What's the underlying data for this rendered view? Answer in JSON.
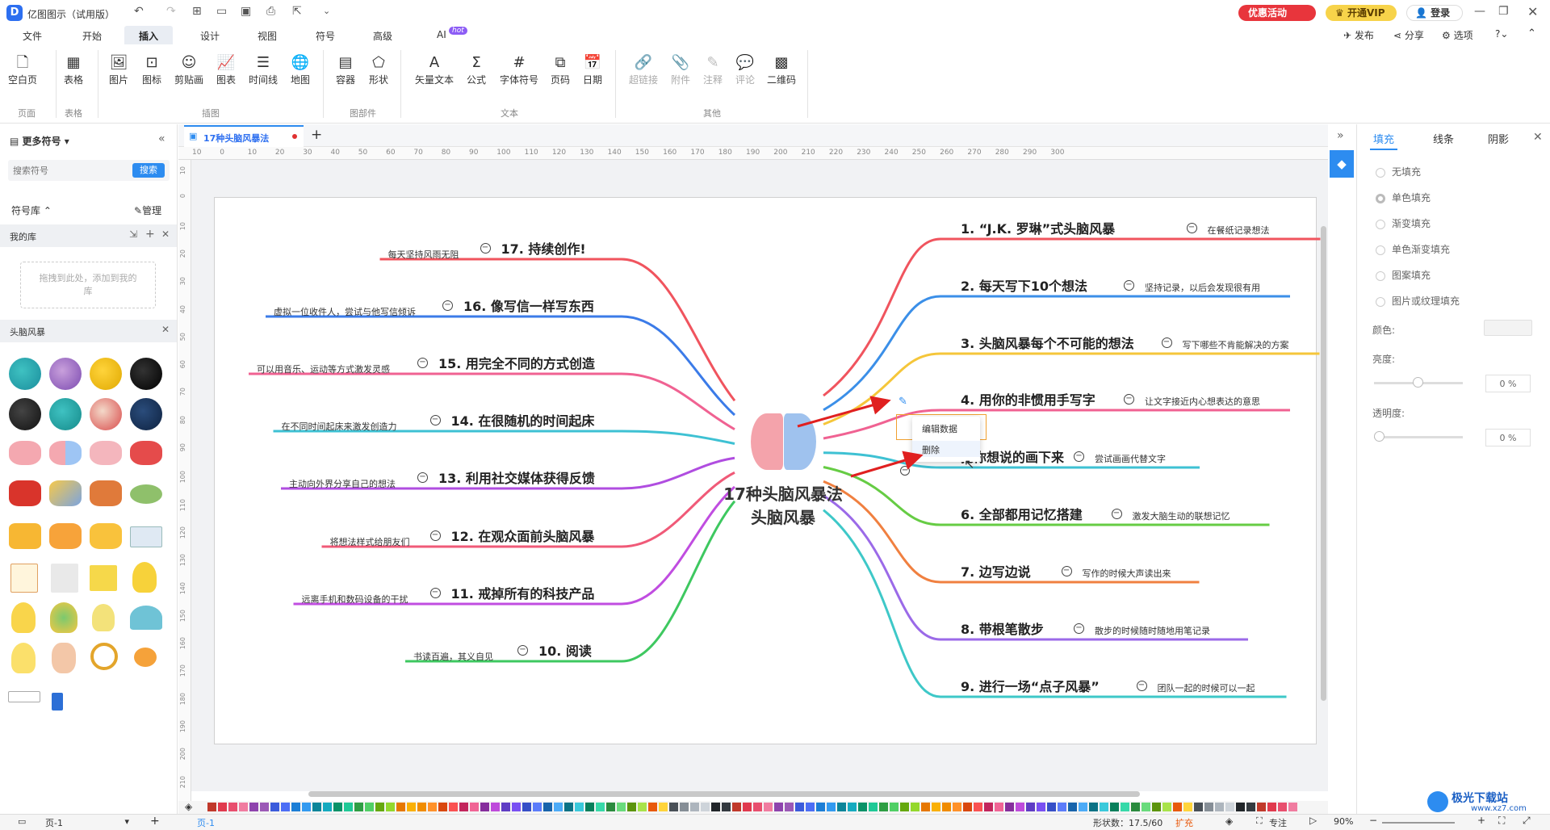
{
  "app": {
    "title": "亿图图示（试用版）",
    "promo_label": "优惠活动",
    "vip_label": "开通VIP",
    "login_label": "登录",
    "publish_label": "发布",
    "share_label": "分享",
    "options_label": "选项"
  },
  "menu": [
    {
      "label": "文件"
    },
    {
      "label": "开始"
    },
    {
      "label": "插入"
    },
    {
      "label": "设计"
    },
    {
      "label": "视图"
    },
    {
      "label": "符号"
    },
    {
      "label": "高级"
    },
    {
      "label": "AI"
    }
  ],
  "ai_badge": "hot",
  "ribbon": {
    "buttons": [
      {
        "label": "空白页"
      },
      {
        "label": "表格"
      },
      {
        "label": "图片"
      },
      {
        "label": "图标"
      },
      {
        "label": "剪贴画"
      },
      {
        "label": "图表"
      },
      {
        "label": "时间线"
      },
      {
        "label": "地图"
      },
      {
        "label": "容器"
      },
      {
        "label": "形状"
      },
      {
        "label": "矢量文本"
      },
      {
        "label": "公式"
      },
      {
        "label": "字体符号"
      },
      {
        "label": "页码"
      },
      {
        "label": "日期"
      },
      {
        "label": "超链接"
      },
      {
        "label": "附件"
      },
      {
        "label": "注释"
      },
      {
        "label": "评论"
      },
      {
        "label": "二维码"
      }
    ],
    "groups": [
      {
        "label": "页面"
      },
      {
        "label": "表格"
      },
      {
        "label": "插图"
      },
      {
        "label": "图部件"
      },
      {
        "label": "文本"
      },
      {
        "label": "其他"
      }
    ]
  },
  "left_panel": {
    "title": "更多符号",
    "search_placeholder": "搜索符号",
    "search_button": "搜索",
    "library_label": "符号库",
    "manage_label": "管理",
    "my_library": "我的库",
    "drop_hint": "拖拽到此处，添加到我的库",
    "category": "头脑风暴"
  },
  "tab": {
    "name": "17种头脑风暴法"
  },
  "ruler": {
    "top": [
      "10",
      "0",
      "10",
      "20",
      "30",
      "40",
      "50",
      "60",
      "70",
      "80",
      "90",
      "100",
      "110",
      "120",
      "130",
      "140",
      "150",
      "160",
      "170",
      "180",
      "190",
      "200",
      "210",
      "220",
      "230",
      "240",
      "250",
      "260",
      "270",
      "280",
      "290",
      "300"
    ],
    "left": [
      "10",
      "0",
      "10",
      "20",
      "30",
      "40",
      "50",
      "60",
      "70",
      "80",
      "90",
      "100",
      "110",
      "120",
      "130",
      "140",
      "150",
      "160",
      "170",
      "180",
      "190",
      "200",
      "210"
    ]
  },
  "mindmap": {
    "center_line1": "17种头脑风暴法",
    "center_line2": "头脑风暴",
    "right": [
      {
        "title": "1. “J.K. 罗琳”式头脑风暴",
        "note": "在餐纸记录想法",
        "color": "#f0545e"
      },
      {
        "title": "2. 每天写下10个想法",
        "note": "坚持记录，以后会发现很有用",
        "color": "#3b8fe8"
      },
      {
        "title": "3. 头脑风暴每个不可能的想法",
        "note": "写下哪些不肯能解决的方案",
        "color": "#f5c63a"
      },
      {
        "title": "4. 用你的非惯用手写字",
        "note": "让文字接近内心想表达的意思",
        "color": "#f06292"
      },
      {
        "title": "把你想说的画下来",
        "note": "尝试画画代替文字",
        "color": "#3ec1d3"
      },
      {
        "title": "6. 全部都用记忆搭建",
        "note": "激发大脑生动的联想记忆",
        "color": "#66cc44"
      },
      {
        "title": "7. 边写边说",
        "note": "写作的时候大声读出来",
        "color": "#f08040"
      },
      {
        "title": "8. 带根笔散步",
        "note": "散步的时候随时随地用笔记录",
        "color": "#9b6ae8"
      },
      {
        "title": "9. 进行一场“点子风暴”",
        "note": "团队一起的时候可以一起",
        "color": "#3ec8c8"
      }
    ],
    "left": [
      {
        "title": "17. 持续创作!",
        "note": "每天坚持风雨无阻",
        "color": "#f0545e"
      },
      {
        "title": "16. 像写信一样写东西",
        "note": "虚拟一位收件人，尝试与他写信倾诉",
        "color": "#3b7be8"
      },
      {
        "title": "15. 用完全不同的方式创造",
        "note": "可以用音乐、运动等方式激发灵感",
        "color": "#f06292"
      },
      {
        "title": "14. 在很随机的时间起床",
        "note": "在不同时间起床来激发创造力",
        "color": "#3ec1d3"
      },
      {
        "title": "13. 利用社交媒体获得反馈",
        "note": "主动向外界分享自己的想法",
        "color": "#b04de0"
      },
      {
        "title": "12. 在观众面前头脑风暴",
        "note": "将想法样式给朋友们",
        "color": "#f05a78"
      },
      {
        "title": "11. 戒掉所有的科技产品",
        "note": "远离手机和数码设备的干扰",
        "color": "#c04de0"
      },
      {
        "title": "10. 阅读",
        "note": "书读百遍，其义自见",
        "color": "#3ec860"
      }
    ]
  },
  "context_menu": {
    "items": [
      {
        "label": "编辑数据"
      },
      {
        "label": "删除"
      }
    ]
  },
  "right_panel": {
    "tabs": [
      {
        "label": "填充"
      },
      {
        "label": "线条"
      },
      {
        "label": "阴影"
      }
    ],
    "fill_options": [
      {
        "label": "无填充"
      },
      {
        "label": "单色填充"
      },
      {
        "label": "渐变填充"
      },
      {
        "label": "单色渐变填充"
      },
      {
        "label": "图案填充"
      },
      {
        "label": "图片或纹理填充"
      }
    ],
    "color_label": "颜色:",
    "brightness_label": "亮度:",
    "brightness_value": "0 %",
    "transparency_label": "透明度:",
    "transparency_value": "0 %"
  },
  "status": {
    "page_selector": "页-1",
    "page_tab": "页-1",
    "shape_count": "形状数：17.5/60",
    "expand": "扩充",
    "focus": "专注",
    "zoom": "90%"
  },
  "palette": [
    "#c0392b",
    "#e03a4e",
    "#e84f6e",
    "#f07ca0",
    "#8e44ad",
    "#9b59b6",
    "#3b5bdb",
    "#4c6ef5",
    "#1c7ed6",
    "#339af0",
    "#0c8599",
    "#15aabf",
    "#099268",
    "#20c997",
    "#2f9e44",
    "#51cf66",
    "#66a80f",
    "#94d82d",
    "#e67700",
    "#fab005",
    "#f08c00",
    "#ff922b",
    "#d9480f",
    "#fa5252",
    "#c2255c",
    "#f06595",
    "#862e9c",
    "#be4bdb",
    "#5f3dc4",
    "#7950f2",
    "#364fc7",
    "#5c7cfa",
    "#1864ab",
    "#4dabf7",
    "#0b7285",
    "#3bc9db",
    "#087f5b",
    "#38d9a9",
    "#2b8a3e",
    "#69db7c",
    "#5c940d",
    "#a9e34b",
    "#e8590c",
    "#ffd43b",
    "#495057",
    "#868e96",
    "#adb5bd",
    "#ced4da",
    "#212529",
    "#343a40"
  ]
}
